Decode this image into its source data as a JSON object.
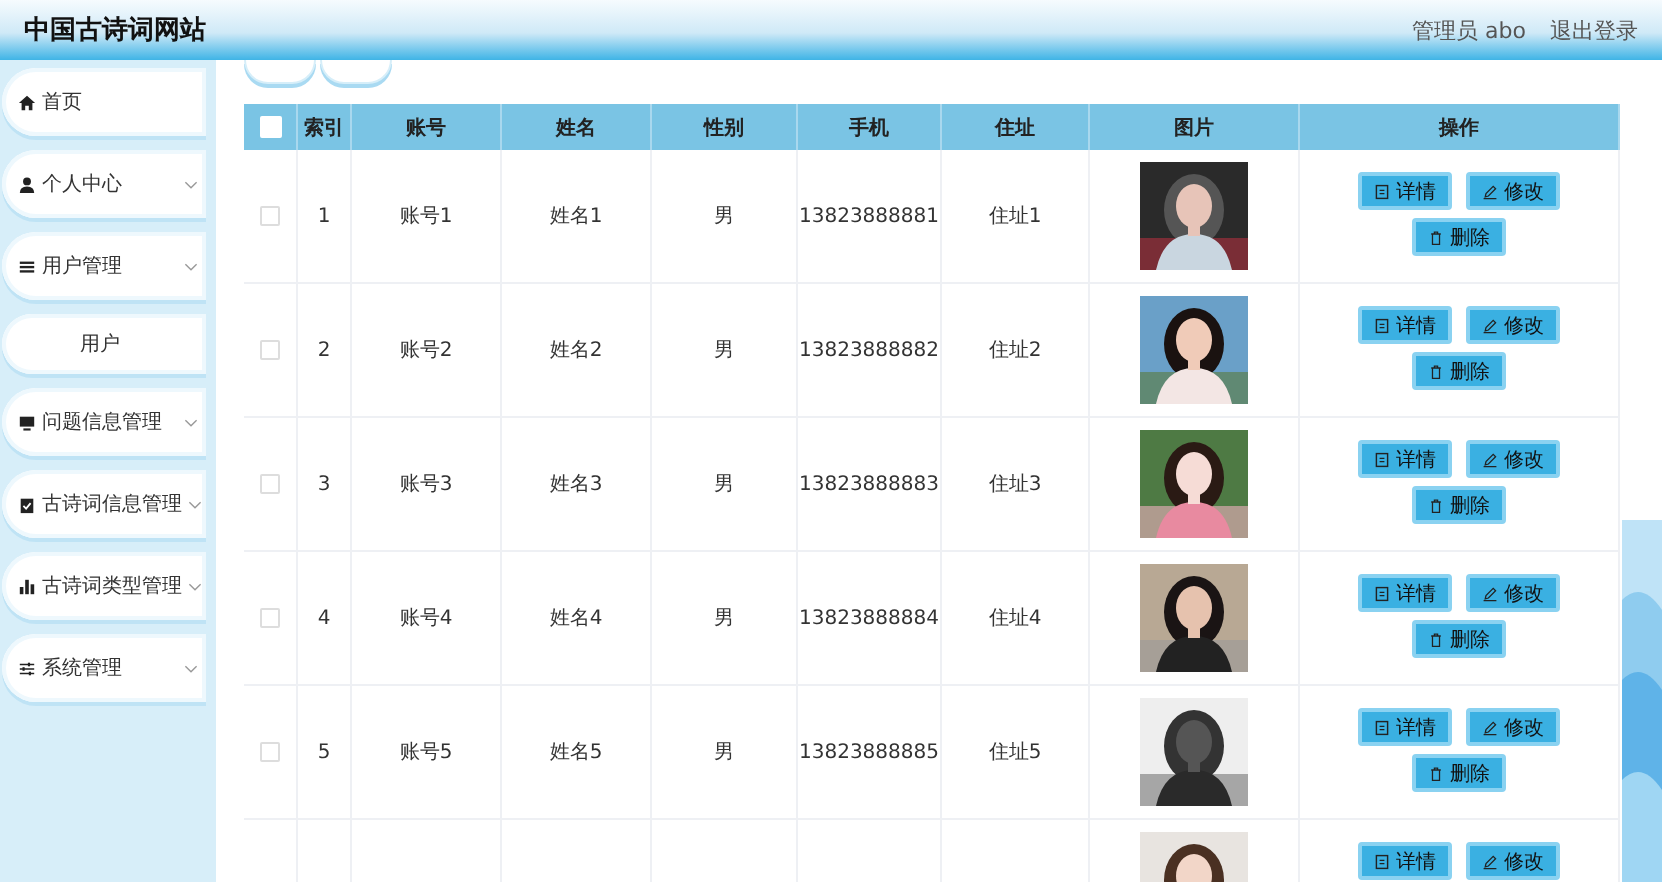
{
  "header": {
    "title": "中国古诗词网站",
    "user": "管理员 abo",
    "logout": "退出登录"
  },
  "sidebar": {
    "items": [
      {
        "label": "首页",
        "expandable": false
      },
      {
        "label": "个人中心",
        "expandable": true
      },
      {
        "label": "用户管理",
        "expandable": true,
        "children": [
          {
            "label": "用户"
          }
        ]
      },
      {
        "label": "问题信息管理",
        "expandable": true
      },
      {
        "label": "古诗词信息管理",
        "expandable": true
      },
      {
        "label": "古诗词类型管理",
        "expandable": true
      },
      {
        "label": "系统管理",
        "expandable": true
      }
    ]
  },
  "table": {
    "all_selected": false,
    "columns": [
      "索引",
      "账号",
      "姓名",
      "性别",
      "手机",
      "住址",
      "图片",
      "操作"
    ],
    "rows": [
      {
        "selected": false,
        "index": "1",
        "account": "账号1",
        "name": "姓名1",
        "gender": "男",
        "phone": "13823888881",
        "address": "住址1",
        "image": {
          "kind": "picture"
        },
        "actions": [
          {
            "kind": "detail",
            "label": "详情"
          },
          {
            "kind": "edit",
            "label": "修改"
          },
          {
            "kind": "delete",
            "label": "删除"
          }
        ]
      },
      {
        "selected": false,
        "index": "2",
        "account": "账号2",
        "name": "姓名2",
        "gender": "男",
        "phone": "13823888882",
        "address": "住址2",
        "image": {
          "kind": "picture"
        },
        "actions": [
          {
            "kind": "detail",
            "label": "详情"
          },
          {
            "kind": "edit",
            "label": "修改"
          },
          {
            "kind": "delete",
            "label": "删除"
          }
        ]
      },
      {
        "selected": false,
        "index": "3",
        "account": "账号3",
        "name": "姓名3",
        "gender": "男",
        "phone": "13823888883",
        "address": "住址3",
        "image": {
          "kind": "picture"
        },
        "actions": [
          {
            "kind": "detail",
            "label": "详情"
          },
          {
            "kind": "edit",
            "label": "修改"
          },
          {
            "kind": "delete",
            "label": "删除"
          }
        ]
      },
      {
        "selected": false,
        "index": "4",
        "account": "账号4",
        "name": "姓名4",
        "gender": "男",
        "phone": "13823888884",
        "address": "住址4",
        "image": {
          "kind": "picture"
        },
        "actions": [
          {
            "kind": "detail",
            "label": "详情"
          },
          {
            "kind": "edit",
            "label": "修改"
          },
          {
            "kind": "delete",
            "label": "删除"
          }
        ]
      },
      {
        "selected": false,
        "index": "5",
        "account": "账号5",
        "name": "姓名5",
        "gender": "男",
        "phone": "13823888885",
        "address": "住址5",
        "image": {
          "kind": "picture"
        },
        "actions": [
          {
            "kind": "detail",
            "label": "详情"
          },
          {
            "kind": "edit",
            "label": "修改"
          },
          {
            "kind": "delete",
            "label": "删除"
          }
        ]
      },
      {
        "image": {
          "kind": "picture"
        },
        "actions": [
          {
            "kind": "detail",
            "label": "详情"
          },
          {
            "kind": "edit",
            "label": "修改"
          }
        ]
      }
    ]
  }
}
